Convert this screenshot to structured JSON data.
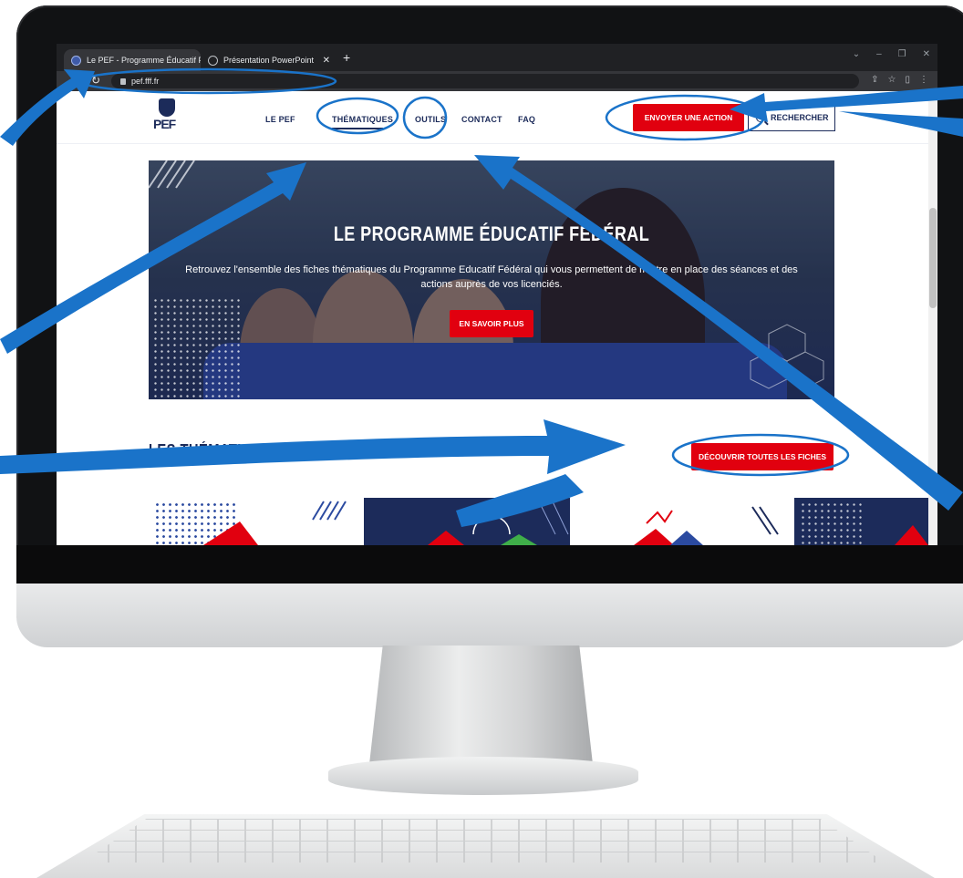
{
  "browser": {
    "tabs": [
      {
        "title": "Le PEF - Programme Éducatif Féd",
        "active": true
      },
      {
        "title": "Présentation PowerPoint",
        "active": false
      }
    ],
    "url": "pef.fff.fr"
  },
  "site": {
    "logo_text": "PEF",
    "nav": [
      "LE PEF",
      "THÉMATIQUES",
      "OUTILS",
      "CONTACT",
      "FAQ"
    ],
    "cta_label": "ENVOYER UNE ACTION",
    "search_label": "RECHERCHER"
  },
  "hero": {
    "title": "LE PROGRAMME ÉDUCATIF FÉDÉRAL",
    "subtitle": "Retrouvez l'ensemble des fiches thématiques du Programme Educatif Fédéral qui vous permettent de mettre en place des séances et des actions auprès de vos licenciés.",
    "button": "EN SAVOIR PLUS"
  },
  "section": {
    "title": "LES THÉMATIQUES DU PEF",
    "button": "DÉCOUVRIR TOUTES LES FICHES"
  },
  "colors": {
    "brand_navy": "#1c2b5a",
    "brand_red": "#e1000f",
    "annotation_blue": "#1a73c9"
  }
}
